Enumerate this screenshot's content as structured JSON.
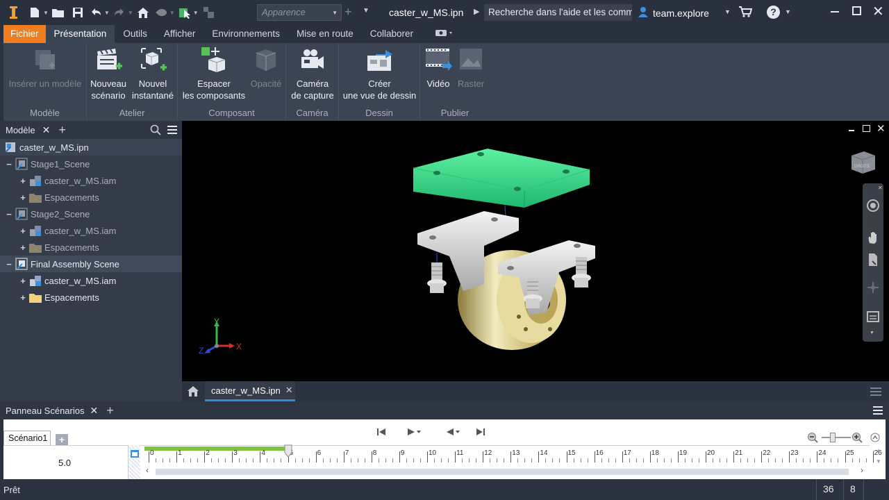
{
  "titlebar": {
    "appearance_placeholder": "Apparence",
    "document_title": "caster_w_MS.ipn",
    "help_search": "Recherche dans l'aide et les comma",
    "user": "team.explore"
  },
  "ribbon_tabs": [
    {
      "label": "Fichier"
    },
    {
      "label": "Présentation"
    },
    {
      "label": "Outils"
    },
    {
      "label": "Afficher"
    },
    {
      "label": "Environnements"
    },
    {
      "label": "Mise en route"
    },
    {
      "label": "Collaborer"
    }
  ],
  "ribbon": {
    "groups": {
      "model": "Modèle",
      "workshop": "Atelier",
      "component": "Composant",
      "camera": "Caméra",
      "drawing": "Dessin",
      "publish": "Publier"
    },
    "buttons": {
      "insert_model": "Insérer un modèle",
      "new_scenario_1": "Nouveau",
      "new_scenario_2": "scénario",
      "new_snapshot_1": "Nouvel",
      "new_snapshot_2": "instantané",
      "tweak_1": "Espacer",
      "tweak_2": "les composants",
      "opacity": "Opacité",
      "capture_camera_1": "Caméra",
      "capture_camera_2": "de capture",
      "create_view_1": "Créer",
      "create_view_2": "une vue de dessin",
      "video": "Vidéo",
      "raster": "Raster"
    }
  },
  "browser": {
    "tab_label": "Modèle",
    "tree": [
      {
        "label": "caster_w_MS.ipn",
        "level": 0
      },
      {
        "label": "Stage1_Scene",
        "level": 1
      },
      {
        "label": "caster_w_MS.iam",
        "level": 2
      },
      {
        "label": "Espacements",
        "level": 2
      },
      {
        "label": "Stage2_Scene",
        "level": 1
      },
      {
        "label": "caster_w_MS.iam",
        "level": 2
      },
      {
        "label": "Espacements",
        "level": 2
      },
      {
        "label": "Final Assembly Scene",
        "level": 1
      },
      {
        "label": "caster_w_MS.iam",
        "level": 2
      },
      {
        "label": "Espacements",
        "level": 2
      }
    ]
  },
  "viewport": {
    "axis_labels": {
      "x": "X",
      "y": "Y",
      "z": "Z"
    },
    "viewcube_label": "DROITE"
  },
  "doc_tab": {
    "label": "caster_w_MS.ipn"
  },
  "scenario_panel": {
    "title": "Panneau Scénarios",
    "scenario_tab": "Scénario1",
    "time_value": "5.0",
    "ruler_labels": [
      "0",
      "1",
      "2",
      "3",
      "4",
      "5",
      "6",
      "7",
      "8",
      "9",
      "10",
      "11",
      "12",
      "13",
      "14",
      "15",
      "16",
      "17",
      "18",
      "19",
      "20",
      "21",
      "22",
      "23",
      "24",
      "25",
      "26"
    ],
    "playhead_seconds": 5
  },
  "status": {
    "text": "Prêt",
    "count_1": "36",
    "count_2": "8"
  },
  "colors": {
    "file_tab": "#f07d1e",
    "active_tab": "#3b4453",
    "accent_blue": "#2f8fd8",
    "timeline_green": "#7ec441"
  }
}
